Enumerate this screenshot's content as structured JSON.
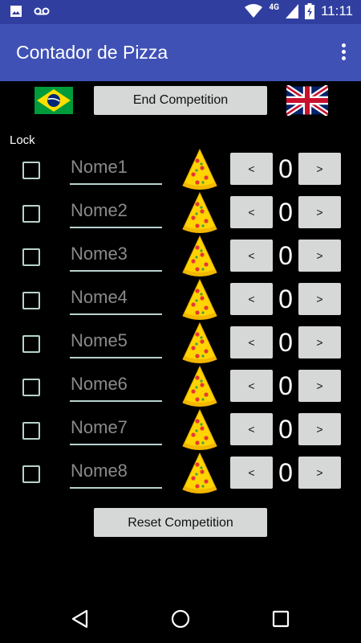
{
  "status_bar": {
    "time": "11:11",
    "network": "4G",
    "icons": [
      "image-icon",
      "voicemail-icon",
      "wifi-icon",
      "signal-icon",
      "battery-icon"
    ]
  },
  "app_bar": {
    "title": "Contador de Pizza",
    "overflow_icon": "more-vert-icon"
  },
  "controls": {
    "end_label": "End Competition",
    "reset_label": "Reset Competition",
    "lock_label": "Lock",
    "flag_left": "brazil-flag-icon",
    "flag_right": "uk-flag-icon"
  },
  "players": [
    {
      "name": "Nome1",
      "count": "0",
      "locked": false
    },
    {
      "name": "Nome2",
      "count": "0",
      "locked": false
    },
    {
      "name": "Nome3",
      "count": "0",
      "locked": false
    },
    {
      "name": "Nome4",
      "count": "0",
      "locked": false
    },
    {
      "name": "Nome5",
      "count": "0",
      "locked": false
    },
    {
      "name": "Nome6",
      "count": "0",
      "locked": false
    },
    {
      "name": "Nome7",
      "count": "0",
      "locked": false
    },
    {
      "name": "Nome8",
      "count": "0",
      "locked": false
    }
  ],
  "stepper": {
    "dec_label": "<",
    "inc_label": ">"
  },
  "colors": {
    "status_bar": "#303F9F",
    "app_bar": "#3F51B5",
    "background": "#000000",
    "button": "#D6D7D7",
    "accent_line": "#B8D3CF"
  }
}
